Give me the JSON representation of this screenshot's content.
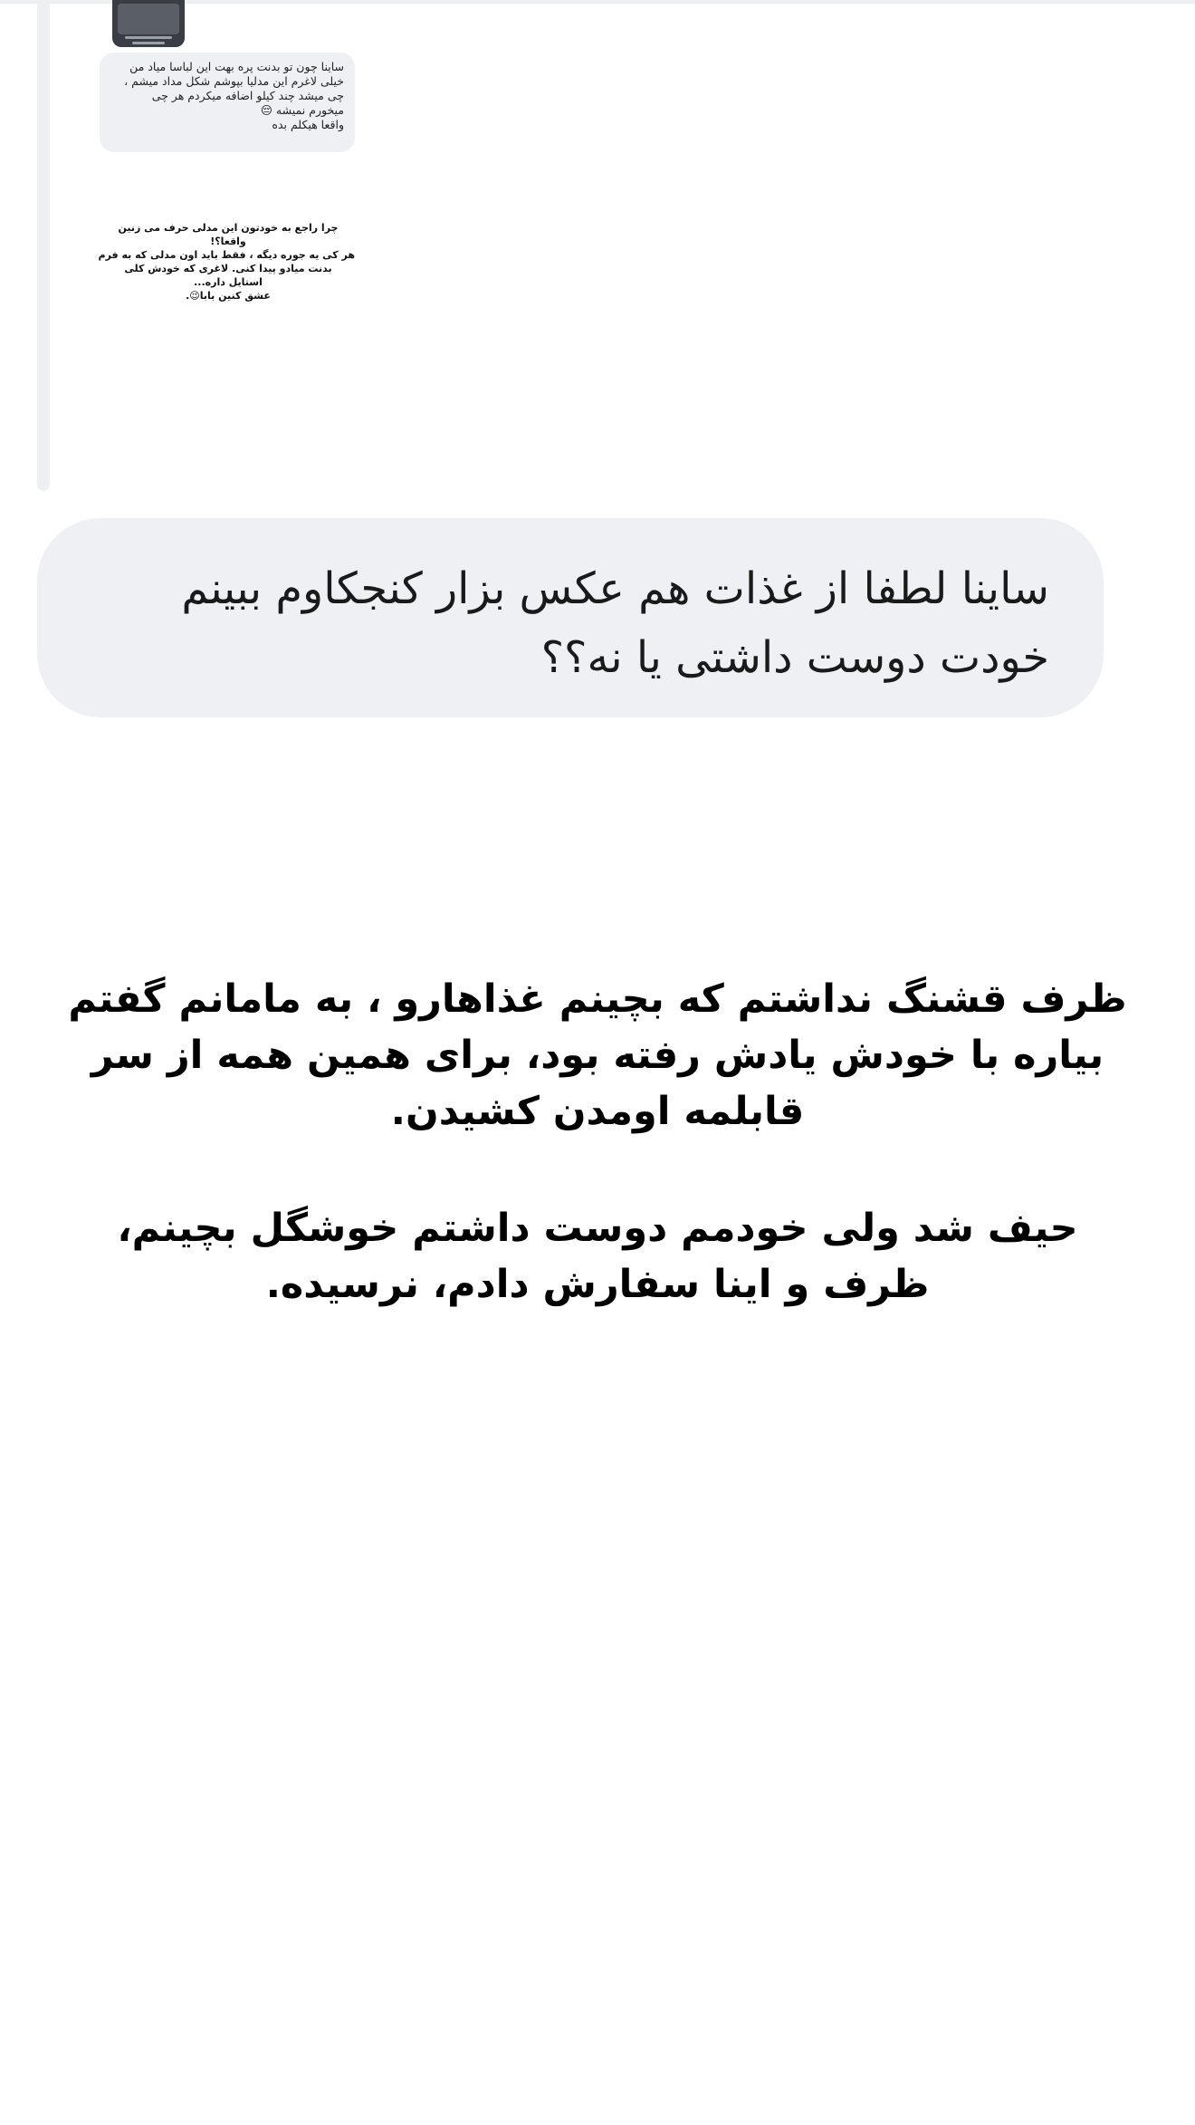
{
  "quoted_reply": {
    "lines": [
      "ساینا چون تو بدنت پره بهت این لباسا میاد من",
      "خیلی لاغرم این مدلیا بپوشم شکل مداد میشم ،",
      "چی میشد چند کیلو اضافه میکردم هر چی",
      "میخورم نمیشه 😔",
      "واقعا هیکلم بده"
    ]
  },
  "sticker_reply": {
    "lines": [
      "چرا راجع به خودتون این مدلی حرف می زنین",
      "واقعا؟!",
      "هر کی یه جوره دیگه ، فقط باید اون مدلی که به فرم",
      "بدنت میادو پیدا کنی. لاغری که خودش کلی",
      "استایل داره...",
      "عشق کنین بابا😉."
    ]
  },
  "message_bubble": {
    "lines": [
      "ساینا لطفا از غذات هم عکس بزار کنجکاوم ببینم",
      "خودت دوست داشتی یا نه؟؟"
    ]
  },
  "story_text": {
    "paragraph_1": [
      "ظرف قشنگ نداشتم که بچینم غذاهارو ، به مامانم گفتم",
      "بیاره با خودش یادش رفته بود، برای همین همه از سر",
      "قابلمه اومدن کشیدن."
    ],
    "paragraph_2": [
      "حیف شد ولی خودمم دوست داشتم خوشگل بچینم،",
      "ظرف و اینا سفارش دادم، نرسیده."
    ]
  },
  "colors": {
    "bubble_background": "#eef0f3",
    "rail": "#eeeff1",
    "text": "#111111"
  }
}
